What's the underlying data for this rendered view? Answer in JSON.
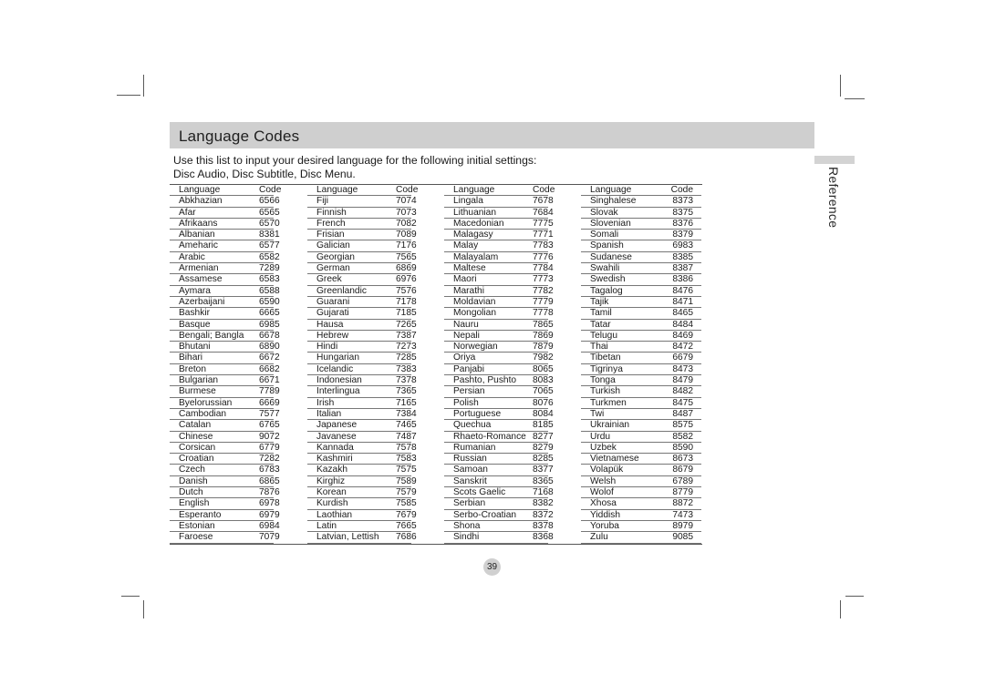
{
  "section_title": "Language Codes",
  "side_tab_label": "Reference",
  "intro_line1": "Use this list to input your desired language for the following initial settings:",
  "intro_line2": "Disc Audio, Disc Subtitle, Disc Menu.",
  "page_number": "39",
  "table": {
    "header": {
      "language": "Language",
      "code": "Code"
    },
    "columns": [
      [
        [
          "Abkhazian",
          "6566"
        ],
        [
          "Afar",
          "6565"
        ],
        [
          "Afrikaans",
          "6570"
        ],
        [
          "Albanian",
          "8381"
        ],
        [
          "Ameharic",
          "6577"
        ],
        [
          "Arabic",
          "6582"
        ],
        [
          "Armenian",
          "7289"
        ],
        [
          "Assamese",
          "6583"
        ],
        [
          "Aymara",
          "6588"
        ],
        [
          "Azerbaijani",
          "6590"
        ],
        [
          "Bashkir",
          "6665"
        ],
        [
          "Basque",
          "6985"
        ],
        [
          "Bengali; Bangla",
          "6678"
        ],
        [
          "Bhutani",
          "6890"
        ],
        [
          "Bihari",
          "6672"
        ],
        [
          "Breton",
          "6682"
        ],
        [
          "Bulgarian",
          "6671"
        ],
        [
          "Burmese",
          "7789"
        ],
        [
          "Byelorussian",
          "6669"
        ],
        [
          "Cambodian",
          "7577"
        ],
        [
          "Catalan",
          "6765"
        ],
        [
          "Chinese",
          "9072"
        ],
        [
          "Corsican",
          "6779"
        ],
        [
          "Croatian",
          "7282"
        ],
        [
          "Czech",
          "6783"
        ],
        [
          "Danish",
          "6865"
        ],
        [
          "Dutch",
          "7876"
        ],
        [
          "English",
          "6978"
        ],
        [
          "Esperanto",
          "6979"
        ],
        [
          "Estonian",
          "6984"
        ],
        [
          "Faroese",
          "7079"
        ]
      ],
      [
        [
          "Fiji",
          "7074"
        ],
        [
          "Finnish",
          "7073"
        ],
        [
          "French",
          "7082"
        ],
        [
          "Frisian",
          "7089"
        ],
        [
          "Galician",
          "7176"
        ],
        [
          "Georgian",
          "7565"
        ],
        [
          "German",
          "6869"
        ],
        [
          "Greek",
          "6976"
        ],
        [
          "Greenlandic",
          "7576"
        ],
        [
          "Guarani",
          "7178"
        ],
        [
          "Gujarati",
          "7185"
        ],
        [
          "Hausa",
          "7265"
        ],
        [
          "Hebrew",
          "7387"
        ],
        [
          "Hindi",
          "7273"
        ],
        [
          "Hungarian",
          "7285"
        ],
        [
          "Icelandic",
          "7383"
        ],
        [
          "Indonesian",
          "7378"
        ],
        [
          "Interlingua",
          "7365"
        ],
        [
          "Irish",
          "7165"
        ],
        [
          "Italian",
          "7384"
        ],
        [
          "Japanese",
          "7465"
        ],
        [
          "Javanese",
          "7487"
        ],
        [
          "Kannada",
          "7578"
        ],
        [
          "Kashmiri",
          "7583"
        ],
        [
          "Kazakh",
          "7575"
        ],
        [
          "Kirghiz",
          "7589"
        ],
        [
          "Korean",
          "7579"
        ],
        [
          "Kurdish",
          "7585"
        ],
        [
          "Laothian",
          "7679"
        ],
        [
          "Latin",
          "7665"
        ],
        [
          "Latvian, Lettish",
          "7686"
        ]
      ],
      [
        [
          "Lingala",
          "7678"
        ],
        [
          "Lithuanian",
          "7684"
        ],
        [
          "Macedonian",
          "7775"
        ],
        [
          "Malagasy",
          "7771"
        ],
        [
          "Malay",
          "7783"
        ],
        [
          "Malayalam",
          "7776"
        ],
        [
          "Maltese",
          "7784"
        ],
        [
          "Maori",
          "7773"
        ],
        [
          "Marathi",
          "7782"
        ],
        [
          "Moldavian",
          "7779"
        ],
        [
          "Mongolian",
          "7778"
        ],
        [
          "Nauru",
          "7865"
        ],
        [
          "Nepali",
          "7869"
        ],
        [
          "Norwegian",
          "7879"
        ],
        [
          "Oriya",
          "7982"
        ],
        [
          "Panjabi",
          "8065"
        ],
        [
          "Pashto, Pushto",
          "8083"
        ],
        [
          "Persian",
          "7065"
        ],
        [
          "Polish",
          "8076"
        ],
        [
          "Portuguese",
          "8084"
        ],
        [
          "Quechua",
          "8185"
        ],
        [
          "Rhaeto-Romance",
          "8277"
        ],
        [
          "Rumanian",
          "8279"
        ],
        [
          "Russian",
          "8285"
        ],
        [
          "Samoan",
          "8377"
        ],
        [
          "Sanskrit",
          "8365"
        ],
        [
          "Scots Gaelic",
          "7168"
        ],
        [
          "Serbian",
          "8382"
        ],
        [
          "Serbo-Croatian",
          "8372"
        ],
        [
          "Shona",
          "8378"
        ],
        [
          "Sindhi",
          "8368"
        ]
      ],
      [
        [
          "Singhalese",
          "8373"
        ],
        [
          "Slovak",
          "8375"
        ],
        [
          "Slovenian",
          "8376"
        ],
        [
          "Somali",
          "8379"
        ],
        [
          "Spanish",
          "6983"
        ],
        [
          "Sudanese",
          "8385"
        ],
        [
          "Swahili",
          "8387"
        ],
        [
          "Swedish",
          "8386"
        ],
        [
          "Tagalog",
          "8476"
        ],
        [
          "Tajik",
          "8471"
        ],
        [
          "Tamil",
          "8465"
        ],
        [
          "Tatar",
          "8484"
        ],
        [
          "Telugu",
          "8469"
        ],
        [
          "Thai",
          "8472"
        ],
        [
          "Tibetan",
          "6679"
        ],
        [
          "Tigrinya",
          "8473"
        ],
        [
          "Tonga",
          "8479"
        ],
        [
          "Turkish",
          "8482"
        ],
        [
          "Turkmen",
          "8475"
        ],
        [
          "Twi",
          "8487"
        ],
        [
          "Ukrainian",
          "8575"
        ],
        [
          "Urdu",
          "8582"
        ],
        [
          "Uzbek",
          "8590"
        ],
        [
          "Vietnamese",
          "8673"
        ],
        [
          "Volapük",
          "8679"
        ],
        [
          "Welsh",
          "6789"
        ],
        [
          "Wolof",
          "8779"
        ],
        [
          "Xhosa",
          "8872"
        ],
        [
          "Yiddish",
          "7473"
        ],
        [
          "Yoruba",
          "8979"
        ],
        [
          "Zulu",
          "9085"
        ]
      ]
    ]
  }
}
